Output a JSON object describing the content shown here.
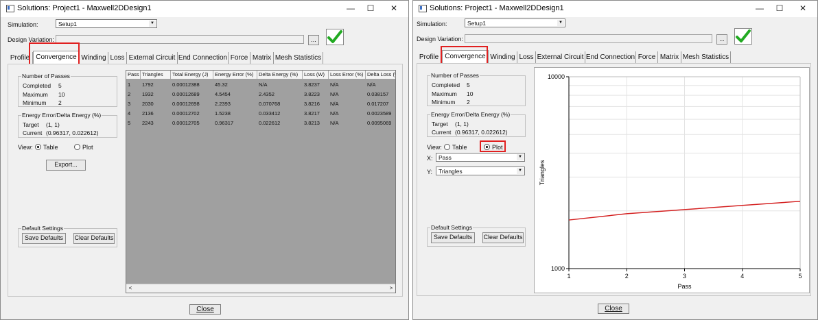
{
  "title": "Solutions: Project1 - Maxwell2DDesign1",
  "simulation_label": "Simulation:",
  "simulation_value": "Setup1",
  "design_variation_label": "Design Variation:",
  "browse_label": "...",
  "tabs": [
    "Profile",
    "Convergence",
    "Winding",
    "Loss",
    "External Circuit",
    "End Connection",
    "Force",
    "Matrix",
    "Mesh Statistics"
  ],
  "passes": {
    "title": "Number of Passes",
    "completed_label": "Completed",
    "completed": "5",
    "maximum_label": "Maximum",
    "maximum": "10",
    "minimum_label": "Minimum",
    "minimum": "2"
  },
  "energy": {
    "title": "Energy Error/Delta Energy (%)",
    "target_label": "Target",
    "target": "(1, 1)",
    "current_label": "Current",
    "current": "(0.96317, 0.022612)"
  },
  "view_label": "View:",
  "view_table": "Table",
  "view_plot": "Plot",
  "export_label": "Export...",
  "x_label": "X:",
  "x_value": "Pass",
  "y_label": "Y:",
  "y_value": "Triangles",
  "defaults": {
    "title": "Default Settings",
    "save": "Save Defaults",
    "clear": "Clear Defaults"
  },
  "close_label": "Close",
  "table": {
    "headers": [
      "Pass",
      "Triangles",
      "Total Energy (J)",
      "Energy Error (%)",
      "Delta Energy (%)",
      "Loss (W)",
      "Loss Error (%)",
      "Delta Loss (%)"
    ],
    "rows": [
      [
        "1",
        "1792",
        "0.00012388",
        "45.32",
        "N/A",
        "3.8237",
        "N/A",
        "N/A"
      ],
      [
        "2",
        "1932",
        "0.00012689",
        "4.5454",
        "2.4352",
        "3.8223",
        "N/A",
        "0.038157"
      ],
      [
        "3",
        "2030",
        "0.00012698",
        "2.2393",
        "0.070768",
        "3.8216",
        "N/A",
        "0.017207"
      ],
      [
        "4",
        "2136",
        "0.00012702",
        "1.5238",
        "0.033412",
        "3.8217",
        "N/A",
        "0.0023589"
      ],
      [
        "5",
        "2243",
        "0.00012705",
        "0.96317",
        "0.022612",
        "3.8213",
        "N/A",
        "0.0095069"
      ]
    ]
  },
  "chart_data": {
    "type": "line",
    "xlabel": "Pass",
    "ylabel": "Triangles",
    "x": [
      1,
      2,
      3,
      4,
      5
    ],
    "series": [
      {
        "values": [
          1792,
          1932,
          2030,
          2136,
          2243
        ],
        "color": "#d42020"
      }
    ],
    "xlim": [
      1,
      5
    ],
    "ylim": [
      1000,
      10000
    ],
    "yscale": "log",
    "x_ticks": [
      "1",
      "2",
      "3",
      "4",
      "5"
    ],
    "y_ticks": [
      "1000",
      "10000"
    ],
    "grid": true
  },
  "colors": {
    "highlight": "#e02020",
    "check": "#22aa22",
    "table_bg": "#a0a0a0"
  }
}
